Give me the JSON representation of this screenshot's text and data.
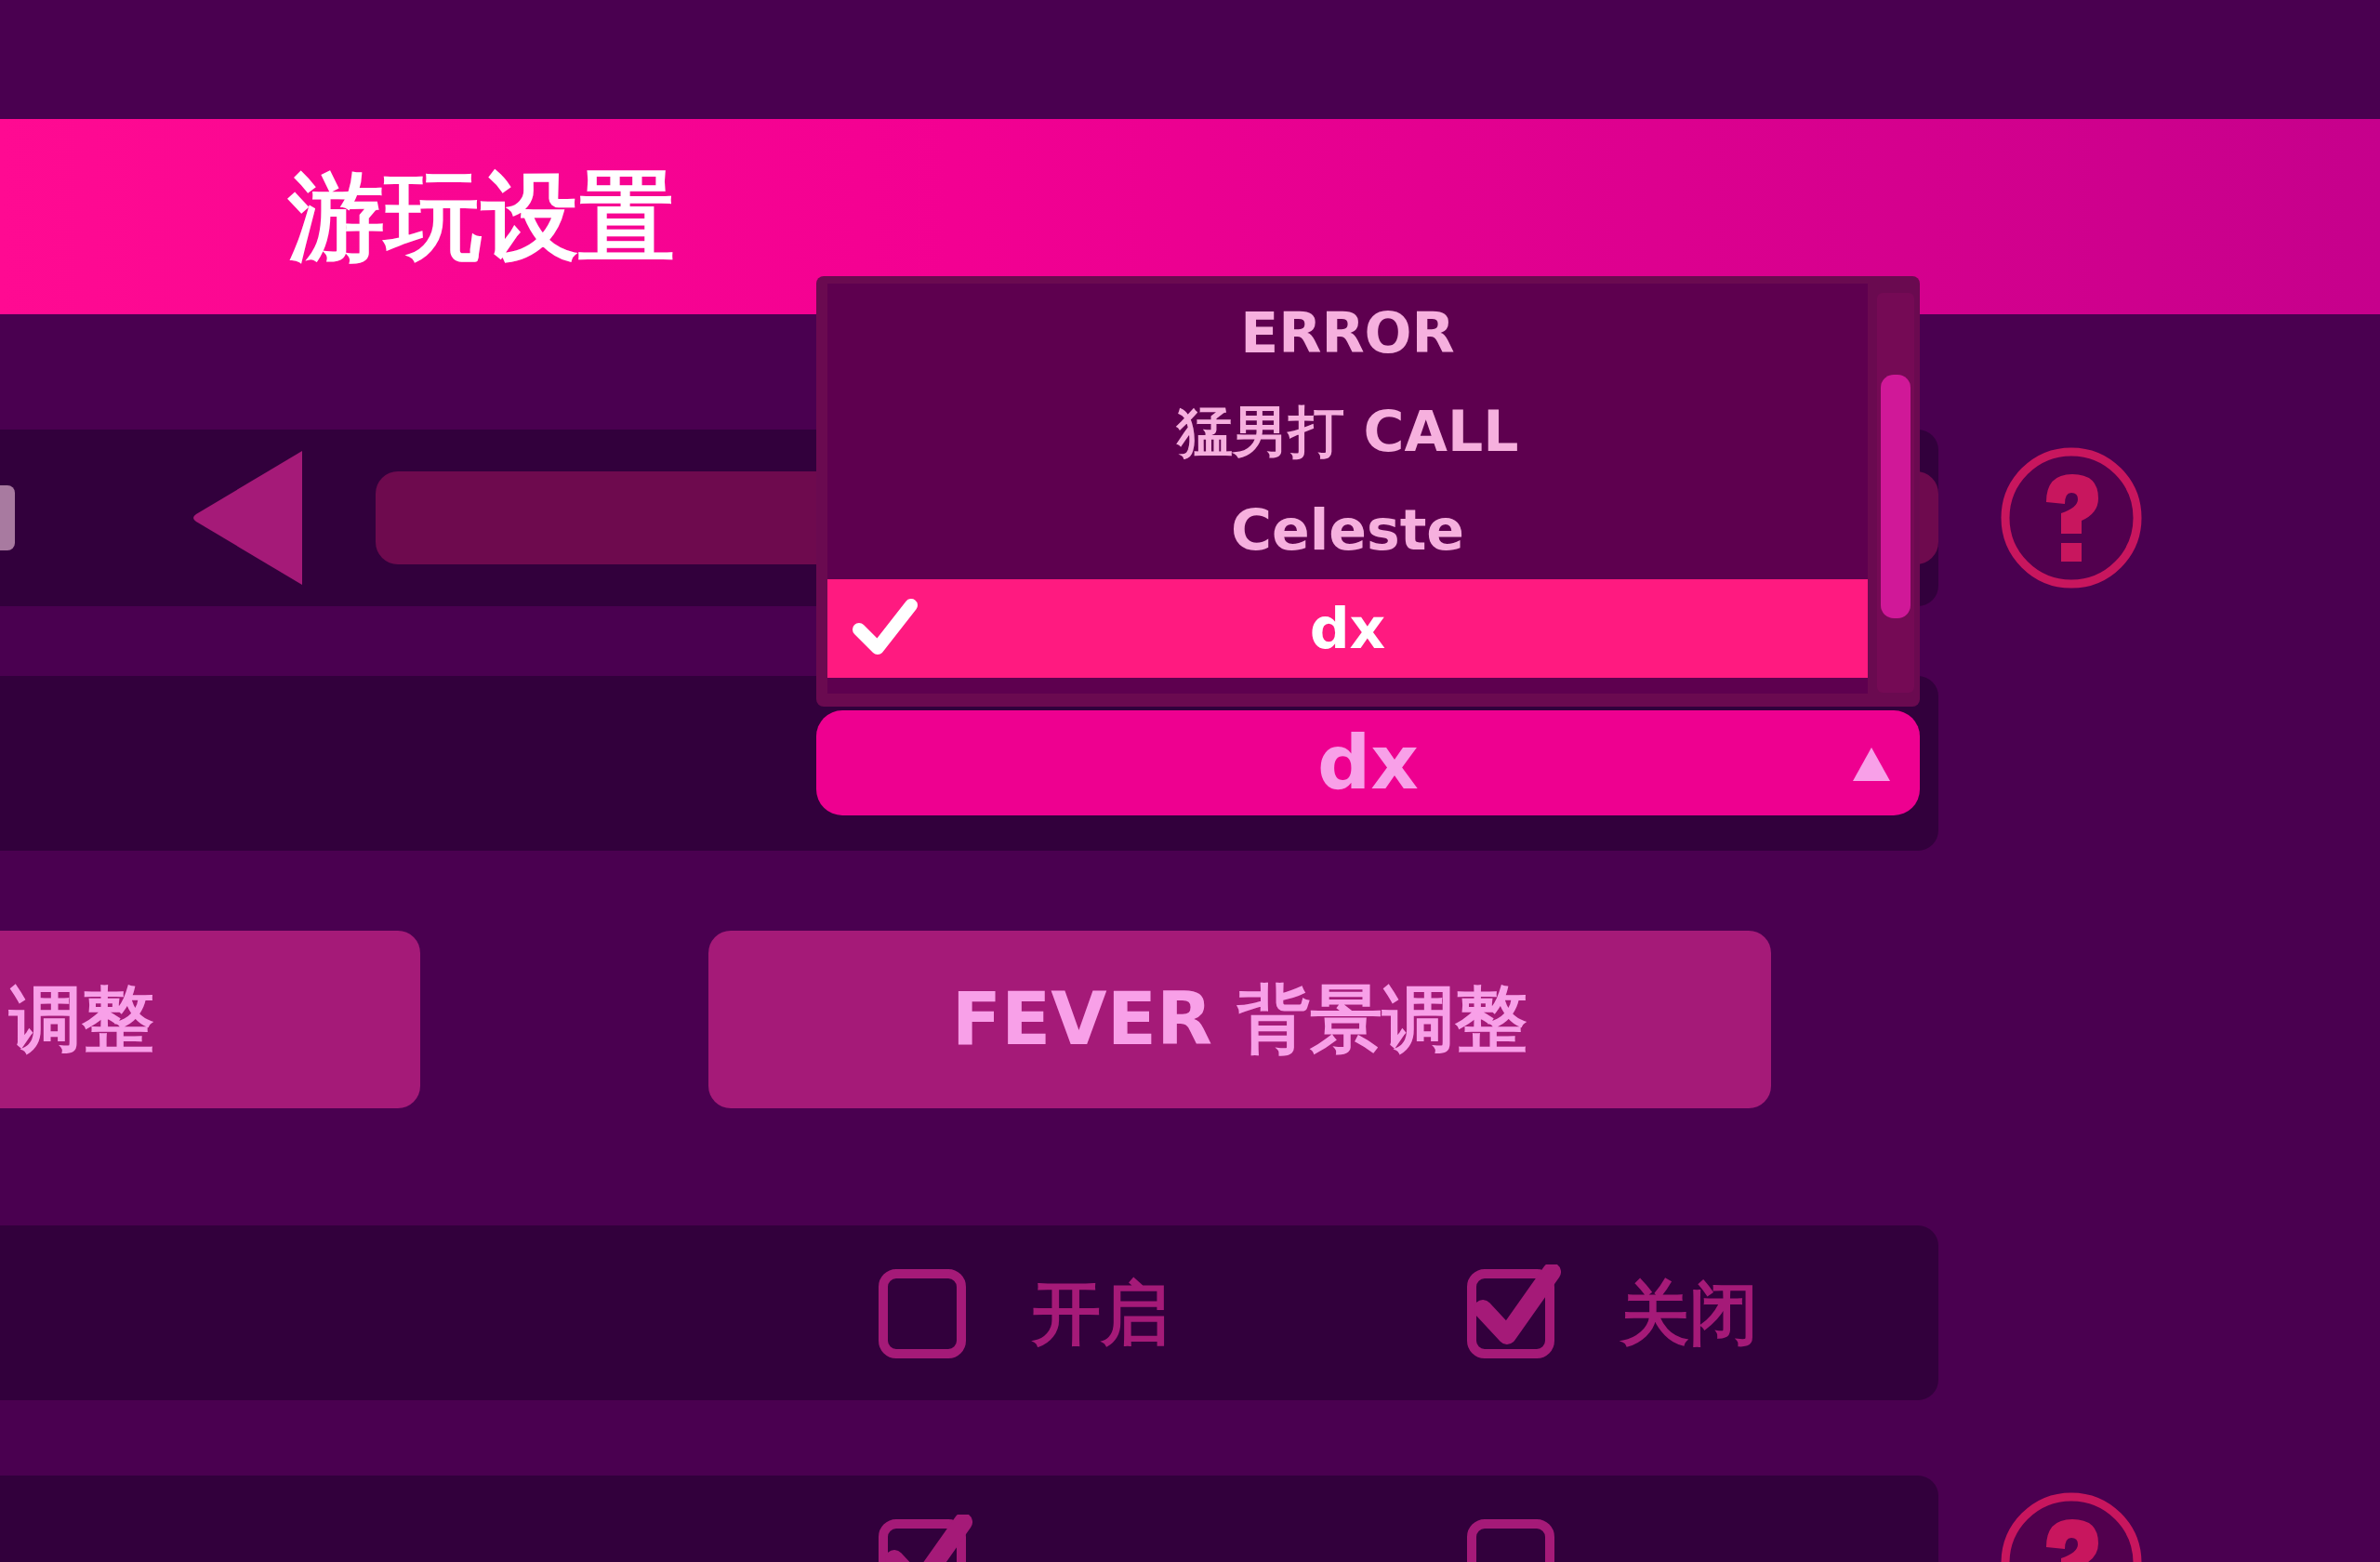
{
  "header": {
    "title": "游玩设置"
  },
  "rows": [
    {
      "kind": "selector",
      "help": true
    },
    {
      "kind": "dropdown",
      "help": false,
      "value": "dx",
      "expanded": true,
      "options": [
        {
          "label": "ERROR",
          "selected": false
        },
        {
          "label": "猛男打 CALL",
          "selected": false
        },
        {
          "label": "Celeste",
          "selected": false
        },
        {
          "label": "dx",
          "selected": true
        }
      ]
    },
    {
      "kind": "buttons",
      "buttons": [
        "调整",
        "FEVER 背景调整"
      ]
    },
    {
      "kind": "toggle",
      "help": false,
      "options": [
        {
          "label": "开启",
          "checked": false
        },
        {
          "label": "关闭",
          "checked": true
        }
      ]
    },
    {
      "kind": "toggle",
      "help": true,
      "options": [
        {
          "checked": true
        },
        {
          "checked": false
        }
      ]
    }
  ]
}
